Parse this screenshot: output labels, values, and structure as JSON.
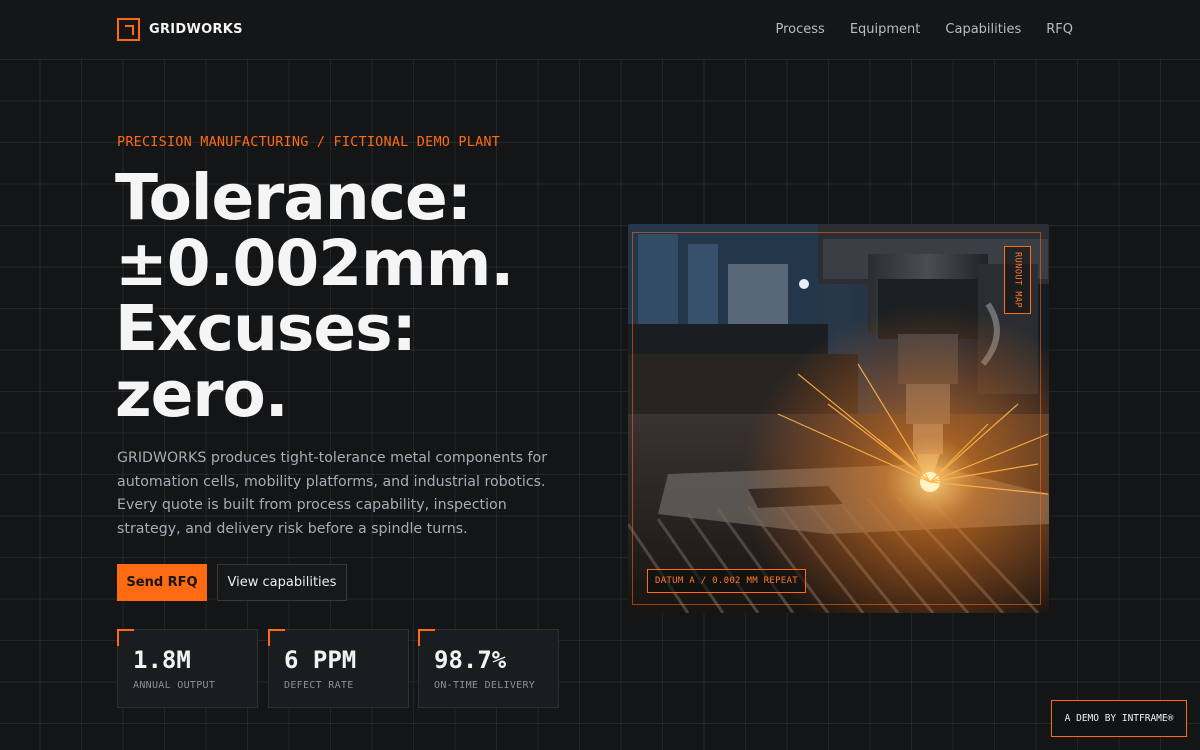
{
  "brand": {
    "name": "GRIDWORKS",
    "accent": "#ff6a13",
    "logo_icon": "corner-bracket-icon"
  },
  "nav": {
    "items": [
      {
        "label": "Process"
      },
      {
        "label": "Equipment"
      },
      {
        "label": "Capabilities"
      },
      {
        "label": "RFQ"
      }
    ]
  },
  "hero": {
    "eyebrow": "PRECISION MANUFACTURING / FICTIONAL DEMO PLANT",
    "headline_lines": [
      "Tolerance:",
      "±0.002mm.",
      "Excuses:",
      "zero."
    ],
    "lede": "GRIDWORKS produces tight-tolerance metal components for automation cells, mobility platforms, and industrial robotics. Every quote is built from process capability, inspection strategy, and delivery risk before a spindle turns.",
    "primary_cta": "Send RFQ",
    "secondary_cta": "View capabilities"
  },
  "stats": [
    {
      "value": "1.8M",
      "label": "ANNUAL OUTPUT"
    },
    {
      "value": "6 PPM",
      "label": "DEFECT RATE"
    },
    {
      "value": "98.7%",
      "label": "ON-TIME DELIVERY"
    }
  ],
  "visual": {
    "image_subject": "laser-cutting-machine-sparks-photo",
    "tag_vertical": "RUNOUT MAP",
    "tag_bottom": "DATUM A / 0.002 MM REPEAT"
  },
  "badge": {
    "label": "A DEMO BY INTFRAME®"
  }
}
